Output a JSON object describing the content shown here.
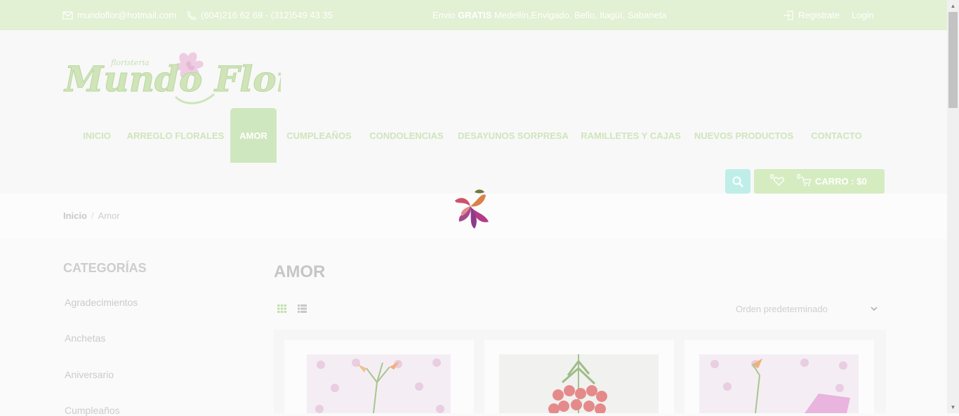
{
  "topbar": {
    "email": "mundoflor@hotmail.com",
    "phone": "(604)216 62 69 - (312)549 43 35",
    "shipping_prefix": "Envio",
    "shipping_bold": "GRATIS",
    "shipping_rest": "Medellín,Envigado, Bello, Itagüí, Sabaneta",
    "register": "Registrate",
    "login": "Login"
  },
  "logo": {
    "small": "floristeria",
    "main": "Mundo Flor"
  },
  "nav": [
    "INICIO",
    "ARREGLO FLORALES",
    "AMOR",
    "CUMPLEAÑOS",
    "CONDOLENCIAS",
    "DESAYUNOS SORPRESA",
    "RAMILLETES Y CAJAS",
    "NUEVOS PRODUCTOS",
    "CONTACTO"
  ],
  "nav_active": "AMOR",
  "cart": {
    "wishlist_count": "0",
    "cart_count": "0",
    "label": "CARRO : $0"
  },
  "breadcrumb": {
    "home": "Inicio",
    "separator": "/",
    "current": "Amor"
  },
  "sidebar": {
    "title": "CATEGORÍAS",
    "items": [
      "Agradecimientos",
      "Anchetas",
      "Aniversario",
      "Cumpleaños"
    ]
  },
  "main": {
    "title": "AMOR",
    "sort_value": "Orden predeterminado"
  },
  "colors": {
    "topbar": "#e2f0d3",
    "accent": "#cfe7be",
    "search": "#bfeee9"
  },
  "icons": [
    "mail-icon",
    "phone-icon",
    "login-icon",
    "search-icon",
    "heart-icon",
    "cart-icon",
    "grid-view-icon",
    "list-view-icon",
    "chevron-down-icon"
  ]
}
